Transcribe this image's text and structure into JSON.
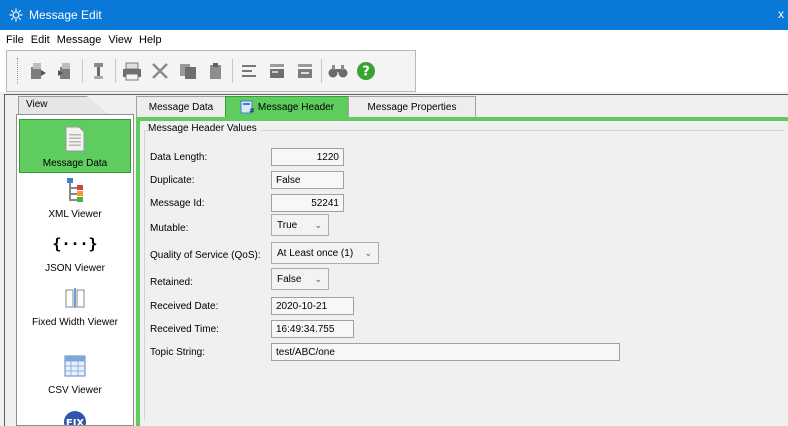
{
  "window": {
    "title": "Message Edit",
    "close_glyph": "x"
  },
  "menu": [
    "File",
    "Edit",
    "Message",
    "View",
    "Help"
  ],
  "toolbar": {
    "icons": [
      "import-icon",
      "export-icon",
      "format-icon",
      "print-icon",
      "cut-icon",
      "copy-icon",
      "paste-icon",
      "align-icon",
      "insert-icon",
      "delete-icon",
      "find-icon",
      "help-icon"
    ]
  },
  "view_panel": {
    "tab_label": "View",
    "items": [
      {
        "label": "Message Data",
        "icon": "document-icon",
        "active": true
      },
      {
        "label": "XML Viewer",
        "icon": "tree-icon",
        "active": false
      },
      {
        "label": "JSON Viewer",
        "icon": "braces-icon",
        "active": false
      },
      {
        "label": "Fixed Width Viewer",
        "icon": "columns-icon",
        "active": false
      },
      {
        "label": "CSV Viewer",
        "icon": "grid-icon",
        "active": false
      },
      {
        "label": "",
        "icon": "fix-icon",
        "active": false
      }
    ]
  },
  "tabs": [
    {
      "label": "Message Data",
      "active": false
    },
    {
      "label": "Message Header",
      "active": true
    },
    {
      "label": "Message Properties",
      "active": false
    }
  ],
  "header": {
    "group_title": "Message Header Values",
    "data_length": {
      "label": "Data Length:",
      "value": "1220"
    },
    "duplicate": {
      "label": "Duplicate:",
      "value": "False"
    },
    "message_id": {
      "label": "Message Id:",
      "value": "52241"
    },
    "mutable": {
      "label": "Mutable:",
      "value": "True"
    },
    "qos": {
      "label": "Quality of Service (QoS):",
      "value": "At Least once (1)"
    },
    "retained": {
      "label": "Retained:",
      "value": "False"
    },
    "received_date": {
      "label": "Received Date:",
      "value": "2020-10-21"
    },
    "received_time": {
      "label": "Received Time:",
      "value": "16:49:34.755"
    },
    "topic_string": {
      "label": "Topic String:",
      "value": "test/ABC/one"
    }
  },
  "colors": {
    "titlebar": "#0a78d7",
    "active_green": "#5ecc5e"
  }
}
